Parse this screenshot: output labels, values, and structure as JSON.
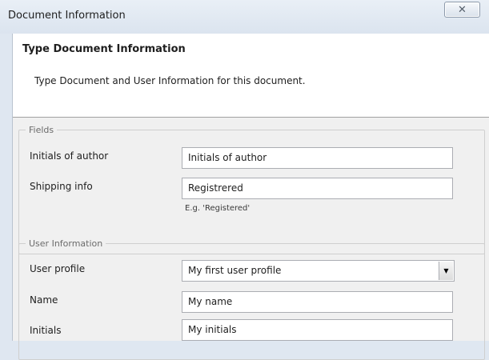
{
  "window": {
    "title": "Document Information",
    "close_glyph": "✕",
    "close_icon": "close-icon"
  },
  "header": {
    "title": "Type Document Information",
    "description": "Type Document and User Information for this document."
  },
  "fields_group": {
    "legend": "Fields",
    "initials_of_author": {
      "label": "Initials of author",
      "value": "Initials of author"
    },
    "shipping_info": {
      "label": "Shipping info",
      "value": "Registrered",
      "hint": "E.g. 'Registered'"
    }
  },
  "user_group": {
    "legend": "User Information",
    "user_profile": {
      "label": "User profile",
      "value": "My first user profile",
      "arrow_glyph": "▼"
    },
    "name": {
      "label": "Name",
      "value": "My name"
    },
    "initials": {
      "label": "Initials",
      "value": "My initials"
    }
  }
}
